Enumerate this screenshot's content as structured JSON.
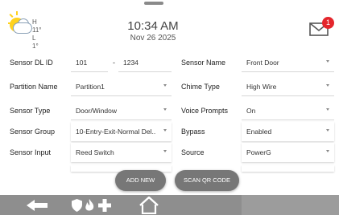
{
  "header": {
    "weather_icon": "partly-cloudy-icon",
    "temp_high": "H 11°",
    "temp_low": "L 1°",
    "time": "10:34 AM",
    "date": "Nov 26 2025",
    "message_count": "1",
    "badge_color": "#e4262c"
  },
  "form": {
    "sensor_dl_id_label": "Sensor DL ID",
    "sensor_dl_id_part1": "101",
    "sensor_dl_id_dash": "-",
    "sensor_dl_id_part2": "1234",
    "sensor_name_label": "Sensor Name",
    "sensor_name_value": "Front Door",
    "partition_name_label": "Partition Name",
    "partition_name_value": "Partition1",
    "chime_type_label": "Chime Type",
    "chime_type_value": "High Wire",
    "sensor_type_label": "Sensor Type",
    "sensor_type_value": "Door/Window",
    "voice_prompts_label": "Voice Prompts",
    "voice_prompts_value": "On",
    "sensor_group_label": "Sensor Group",
    "sensor_group_value": "10-Entry-Exit-Normal Del..",
    "bypass_label": "Bypass",
    "bypass_value": "Enabled",
    "sensor_input_label": "Sensor Input",
    "sensor_input_value": "Reed Switch",
    "source_label": "Source",
    "source_value": "PowerG"
  },
  "buttons": {
    "add_new": "ADD NEW",
    "scan_qr": "SCAN QR CODE"
  },
  "navbar": {
    "icons": [
      "back-arrow-icon",
      "shield-icon",
      "fire-icon",
      "medical-cross-icon",
      "home-icon"
    ],
    "bar_color": "#9c9c9c"
  }
}
